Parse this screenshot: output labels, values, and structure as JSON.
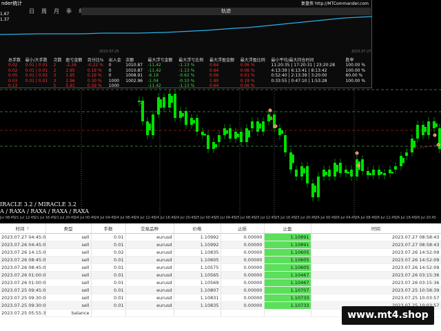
{
  "stats": {
    "title": "nder统计",
    "link": "复盘侠 http://MTCommander.com",
    "menu": [
      "日",
      "周",
      "月",
      "季",
      "年",
      "账户"
    ],
    "tab": "轨迹",
    "levels": [
      "1.67",
      "1.37"
    ],
    "date_left": "2023.07.25",
    "date_right": "2023.07.27",
    "headers": [
      "总手数",
      "最小/大手数",
      "次数",
      "盈亏金额",
      "百分比%",
      "出入金",
      "余额",
      "最大浮亏金额",
      "最大浮亏比例",
      "最大浮盈金额",
      "最大浮盈比例",
      "最小平均/最大持仓时间",
      "胜率"
    ],
    "rows": [
      [
        "0.02",
        "0.01 | 0.01",
        "2",
        "-2.26",
        "-0.22 %",
        "0",
        "1010.87",
        "-11.42",
        "-1.13 %",
        "0.64",
        "0.06 %",
        "11:20:35 | 17:20:31 | 23:20:28",
        "100.00 %"
      ],
      [
        "0.02",
        "0.01 | 0.01",
        "2",
        "1.95",
        "0.19 %",
        "0",
        "1010.87",
        "-11.42",
        "-1.13 %",
        "0.64",
        "0.06 %",
        "4:13:39 | 6:13:41 | 8:13:42",
        "100.00 %"
      ],
      [
        "0.05",
        "0.01 | 0.02",
        "3",
        "1.95",
        "0.19 %",
        "0",
        "1008.91",
        "-6.19",
        "-0.62 %",
        "0.06",
        "0.01 %",
        "0:52:40 | 2:13:39 | 3:20:00",
        "60.00 %"
      ],
      [
        "0.03",
        "0.01 | 0.01",
        "3",
        "2.96",
        "0.30 %",
        "1000",
        "1002.96",
        "-1.04",
        "-0.10 %",
        "1.90",
        "0.19 %",
        "0:33:55 | 0:47:10 | 1:53:28",
        "100.00 %"
      ],
      [
        "0.13",
        "",
        "5",
        "5.91",
        "0.59 %",
        "1000",
        "",
        "-11.42",
        "-1.13 %",
        "0.64",
        "0.06 %",
        "",
        ""
      ]
    ]
  },
  "chart_labels": {
    "ea_1": "IRACLE 3.2   / MIRACLE 3.2",
    "ea_2": "A / RAXA / RAXA / RAXA / RAXA"
  },
  "time_axis": [
    "21 Jul 08:45",
    "21 Jul 12:45",
    "21 Jul 16:45",
    "21 Jul 20:45",
    "24 Jul 00:45",
    "24 Jul 04:45",
    "24 Jul 08:45",
    "24 Jul 12:45",
    "24 Jul 16:45",
    "24 Jul 20:45",
    "25 Jul 00:45",
    "25 Jul 04:45",
    "25 Jul 08:45",
    "25 Jul 12:45",
    "25 Jul 16:45",
    "25 Jul 20:45",
    "26 Jul 00:45",
    "26 Jul 04:45",
    "26 Jul 08:45",
    "26 Jul 12:45",
    "26 Jul 16:45",
    "26 Jul 20:45"
  ],
  "orders": {
    "headers": [
      "时间",
      "类型",
      "手数",
      "交易品种",
      "价格",
      "止损",
      "止盈",
      "时间"
    ],
    "sort_icon": "sort-arrow-icon",
    "rows": [
      [
        "2023.07.27 04:45:04",
        "sell",
        "0.01",
        "eurusd",
        "1.10992",
        "0.00000",
        "1.10891",
        "2023.07.27 08:58:43"
      ],
      [
        "2023.07.26 04:45:02",
        "sell",
        "0.01",
        "eurusd",
        "1.10992",
        "0.00000",
        "1.10891",
        "2023.07.27 08:58:43"
      ],
      [
        "2023.07.26 14:15:01",
        "sell",
        "0.02",
        "eurusd",
        "1.10835",
        "0.00000",
        "1.10605",
        "2023.07.26 14:52:09"
      ],
      [
        "2023.07.26 08:45:01",
        "sell",
        "0.01",
        "eurusd",
        "1.10605",
        "0.00000",
        "1.10605",
        "2023.07.26 14:52:09"
      ],
      [
        "2023.07.26 08:45:00",
        "sell",
        "0.01",
        "eurusd",
        "1.10575",
        "0.00000",
        "1.10605",
        "2023.07.26 14:52:09"
      ],
      [
        "2023.07.26 01:00:02",
        "sell",
        "0.01",
        "eurusd",
        "1.10565",
        "0.00000",
        "1.10467",
        "2023.07.26 03:15:36"
      ],
      [
        "2023.07.26 01:00:01",
        "sell",
        "0.01",
        "eurusd",
        "1.10569",
        "0.00000",
        "1.10467",
        "2023.07.26 03:15:36"
      ],
      [
        "2023.07.25 09:45:01",
        "sell",
        "0.01",
        "eurusd",
        "1.10807",
        "0.00000",
        "1.10707",
        "2023.07.25 10:58:39"
      ],
      [
        "2023.07.25 09:30:02",
        "sell",
        "0.01",
        "eurusd",
        "1.10831",
        "0.00000",
        "1.10733",
        "2023.07.25 10:03:57"
      ],
      [
        "2023.07.25 09:30:00",
        "sell",
        "0.01",
        "eurusd",
        "1.10835",
        "0.00000",
        "1.10733",
        "2023.07.25 10:03:57"
      ],
      [
        "2023.07.25 05:55:35",
        "balance",
        "",
        "",
        "",
        "",
        "",
        ""
      ]
    ]
  },
  "watermark": "www.mt4.shop",
  "colors": {
    "profit": "#5be05b",
    "loss": "#ff3030",
    "candle": "#00e000",
    "equity_line": "#2bb0e8"
  }
}
